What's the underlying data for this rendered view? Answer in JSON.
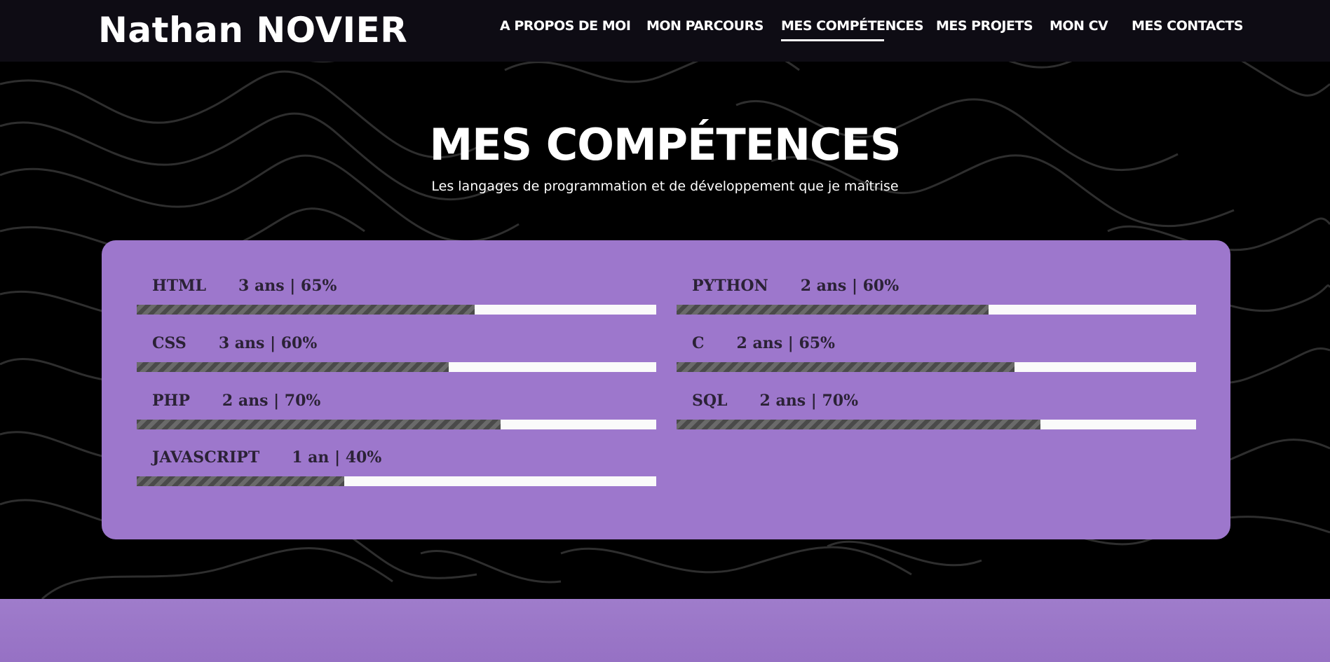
{
  "header": {
    "logo": "Nathan NOVIER",
    "nav": [
      {
        "label": "A PROPOS DE MOI",
        "active": false
      },
      {
        "label": "MON PARCOURS",
        "active": false
      },
      {
        "label": "MES COMPÉTENCES",
        "active": true
      },
      {
        "label": "MES PROJETS",
        "active": false
      },
      {
        "label": "MON CV",
        "active": false
      },
      {
        "label": "MES CONTACTS",
        "active": false
      }
    ]
  },
  "section": {
    "title": "MES COMPÉTENCES",
    "subtitle": "Les langages de programmation et de développement que je maîtrise"
  },
  "skills": [
    {
      "name": "HTML",
      "meta": "3 ans | 65%",
      "percent": 65
    },
    {
      "name": "PYTHON",
      "meta": "2 ans | 60%",
      "percent": 60
    },
    {
      "name": "CSS",
      "meta": "3 ans | 60%",
      "percent": 60
    },
    {
      "name": "C",
      "meta": "2 ans | 65%",
      "percent": 65
    },
    {
      "name": "PHP",
      "meta": "2 ans | 70%",
      "percent": 70
    },
    {
      "name": "SQL",
      "meta": "2 ans | 70%",
      "percent": 70
    },
    {
      "name": "JAVASCRIPT",
      "meta": "1 an | 40%",
      "percent": 40
    }
  ],
  "colors": {
    "accent": "#9d77cc",
    "header_bg": "#0e0c14",
    "page_bg": "#000000",
    "bar_track": "#fafafa",
    "bar_fill": "#4a4a4a",
    "skill_text": "#2b2236"
  }
}
